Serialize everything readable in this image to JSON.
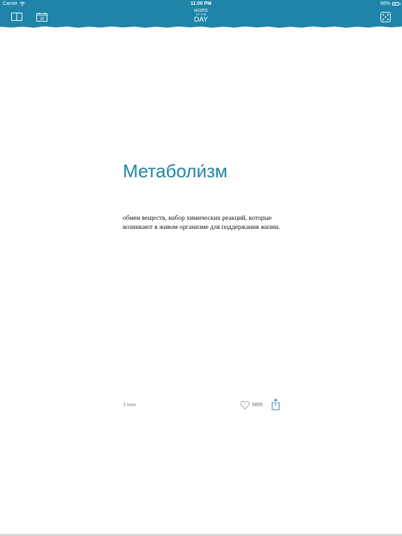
{
  "status": {
    "carrier": "Carrier",
    "time": "11:00 PM",
    "battery": "66%",
    "battery_level": 0.66
  },
  "nav": {
    "logo_top": "WORD",
    "logo_mid": "OF THE",
    "logo_bottom": "DAY",
    "calendar_label": "30"
  },
  "word": {
    "title": "Метаболи́зм",
    "definition": "обмен веществ, набор химических реакций, которые возникают в живом организме для поддержания жизни."
  },
  "footer": {
    "date": "3 мая",
    "likes": "5855"
  },
  "colors": {
    "brand": "#1f84a8",
    "background": "#ffffff"
  },
  "icons": [
    "book-icon",
    "calendar-icon",
    "dice-icon",
    "wifi-icon",
    "battery-icon",
    "heart-icon",
    "share-icon"
  ]
}
